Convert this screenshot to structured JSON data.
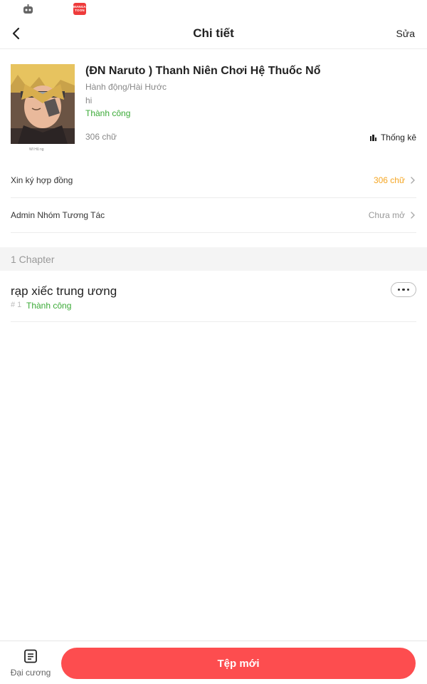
{
  "status_bar": {
    "icons": [
      "bot-notification-icon",
      "mangatoon-app-icon"
    ],
    "app_icon_text": "MANGA TOON"
  },
  "header": {
    "title": "Chi tiết",
    "edit_label": "Sửa",
    "back_icon": "chevron-left-icon"
  },
  "book": {
    "title": "(ĐN Naruto ) Thanh Niên Chơi Hệ Thuốc Nổ",
    "genre": "Hành động/Hài Hước",
    "description": "hi",
    "status": "Thành công",
    "word_count": "306 chữ",
    "stats_label": "Thống kê",
    "cover_caption": "Wl Hũ ng",
    "colors": {
      "status": "#3aaa36"
    }
  },
  "rows": [
    {
      "label": "Xin ký hợp đồng",
      "value": "306 chữ",
      "value_color": "#f5a623"
    },
    {
      "label": "Admin Nhóm Tương Tác",
      "value": "Chưa mở",
      "value_color": "#999999"
    }
  ],
  "chapters": {
    "header": "1 Chapter",
    "items": [
      {
        "title": "rạp xiếc trung ương",
        "number": "# 1",
        "status": "Thành công"
      }
    ]
  },
  "bottom": {
    "outline_label": "Đại cương",
    "new_file_label": "Tệp mới",
    "accent": "#fd4d4f"
  }
}
